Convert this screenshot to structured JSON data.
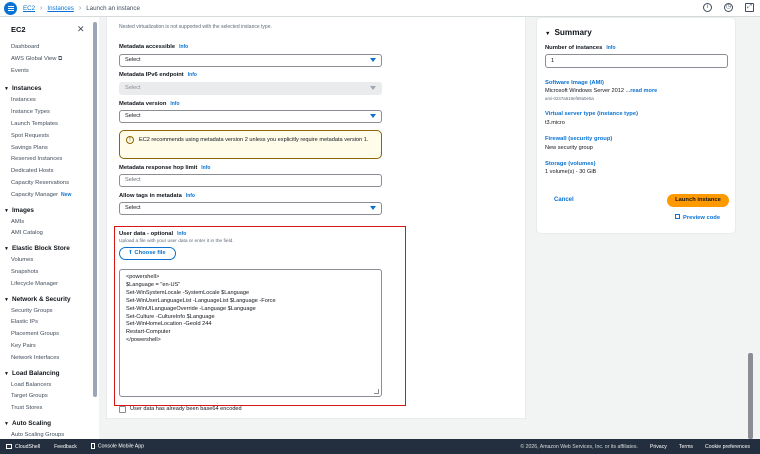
{
  "breadcrumbs": [
    "EC2",
    "Instances",
    "Launch an instance"
  ],
  "sidebar": {
    "title": "EC2",
    "sections": [
      {
        "heading": null,
        "items": [
          "Dashboard",
          "AWS Global View",
          "Events"
        ]
      },
      {
        "heading": "Instances",
        "items": [
          "Instances",
          "Instance Types",
          "Launch Templates",
          "Spot Requests",
          "Savings Plans",
          "Reserved Instances",
          "Dedicated Hosts",
          "Capacity Reservations",
          "Capacity Manager"
        ]
      },
      {
        "heading": "Images",
        "items": [
          "AMIs",
          "AMI Catalog"
        ]
      },
      {
        "heading": "Elastic Block Store",
        "items": [
          "Volumes",
          "Snapshots",
          "Lifecycle Manager"
        ]
      },
      {
        "heading": "Network & Security",
        "items": [
          "Security Groups",
          "Elastic IPs",
          "Placement Groups",
          "Key Pairs",
          "Network Interfaces"
        ]
      },
      {
        "heading": "Load Balancing",
        "items": [
          "Load Balancers",
          "Target Groups",
          "Trust Stores"
        ]
      },
      {
        "heading": "Auto Scaling",
        "items": [
          "Auto Scaling Groups"
        ]
      }
    ],
    "new_badge": "New"
  },
  "form": {
    "top_note": "Nested virtualization is not supported with the selected instance type.",
    "info": "Info",
    "metadata_accessible": {
      "label": "Metadata accessible",
      "value": "Select"
    },
    "metadata_ipv6": {
      "label": "Metadata IPv6 endpoint",
      "value": "Select"
    },
    "metadata_version": {
      "label": "Metadata version",
      "value": "Select"
    },
    "alert_text": "EC2 recommends using metadata version 2 unless you explicitly require metadata version 1.",
    "hop_limit": {
      "label": "Metadata response hop limit",
      "placeholder": "Select"
    },
    "allow_tags": {
      "label": "Allow tags in metadata",
      "value": "Select"
    },
    "user_data": {
      "label": "User data - optional",
      "description": "Upload a file with your user data or enter it in the field.",
      "choose_file": "Choose file",
      "lines": [
        "<powershell>",
        "$Language = \"en-US\"",
        "Set-WinSystemLocale -SystemLocale $Language",
        "Set-WinUserLanguageList -LanguageList $Language -Force",
        "Set-WinUILanguageOverride -Language $Language",
        "Set-Culture -CultureInfo $Language",
        "Set-WinHomeLocation -GeoId 244",
        "Restart-Computer",
        "</powershell>"
      ],
      "base64_checkbox": "User data has already been base64 encoded"
    }
  },
  "summary": {
    "title": "Summary",
    "num_instances_label": "Number of instances",
    "num_instances_value": "1",
    "info": "Info",
    "ami_label": "Software Image (AMI)",
    "ami_value": "Microsoft Windows Server 2012 ...",
    "read_more": "read more",
    "ami_id": "ami-0247a619ef69a0e5a",
    "type_label": "Virtual server type (instance type)",
    "type_value": "t3.micro",
    "firewall_label": "Firewall (security group)",
    "firewall_value": "New security group",
    "storage_label": "Storage (volumes)",
    "storage_value": "1 volume(s) - 30 GiB",
    "cancel": "Cancel",
    "launch": "Launch instance",
    "preview": "Preview code"
  },
  "footer": {
    "cloudshell": "CloudShell",
    "feedback": "Feedback",
    "console_mobile": "Console Mobile App",
    "copyright": "© 2026, Amazon Web Services, Inc. or its affiliates.",
    "privacy": "Privacy",
    "terms": "Terms",
    "cookies": "Cookie preferences"
  },
  "colors": {
    "accent": "#0972d3",
    "launch": "#ff9900",
    "highlight": "#d91515",
    "footer": "#232f3e"
  }
}
